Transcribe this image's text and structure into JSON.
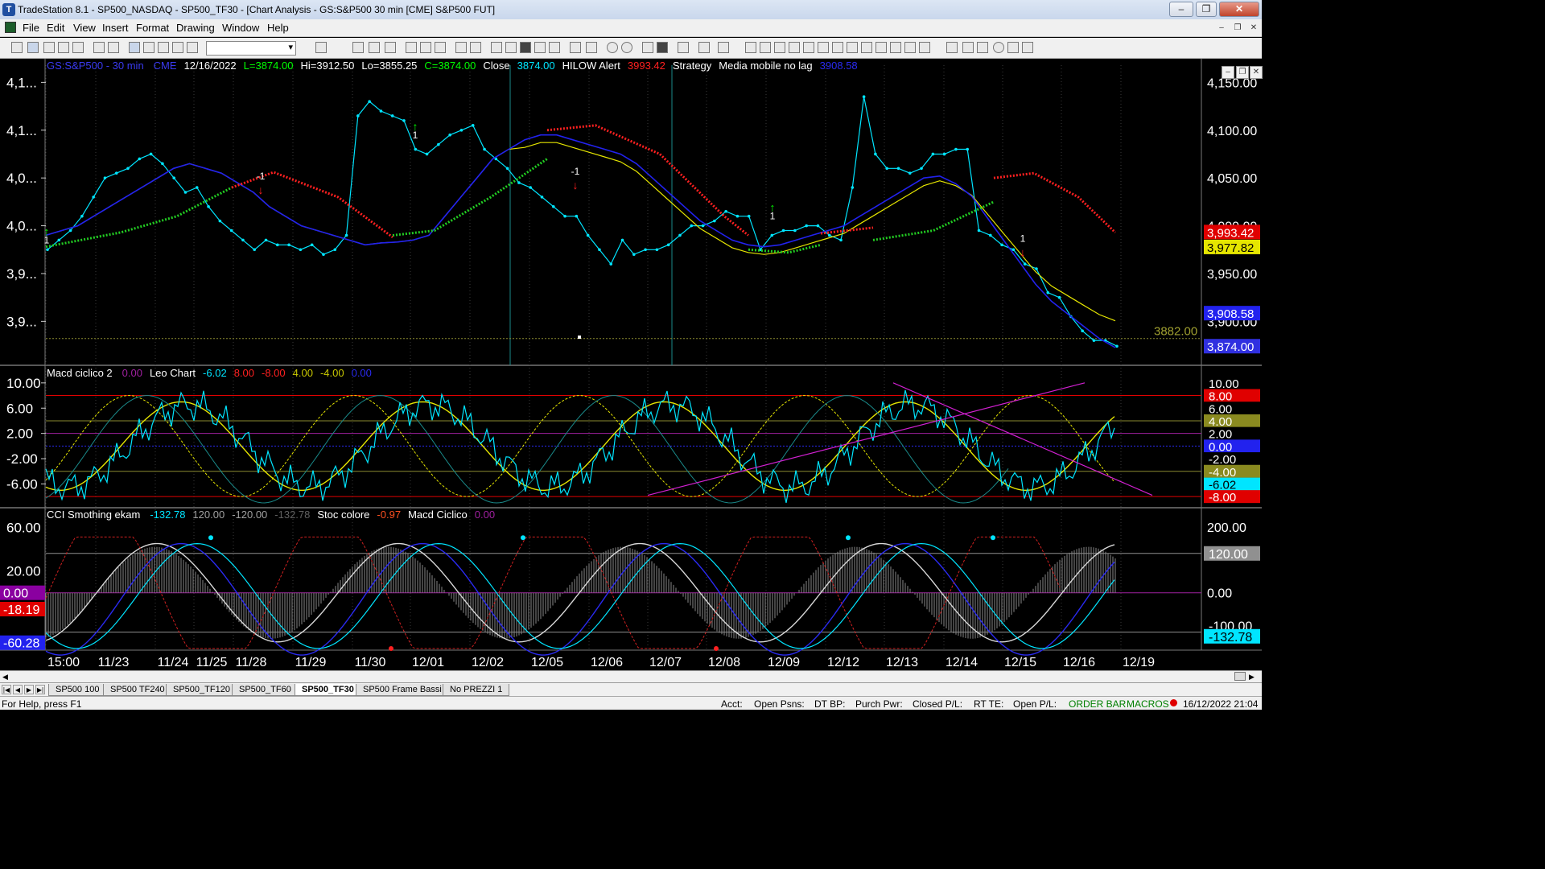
{
  "window": {
    "title": "TradeStation 8.1 - SP500_NASDAQ - SP500_TF30 - [Chart Analysis - GS:S&P500  30 min  [CME] S&P500 FUT]"
  },
  "menu": [
    "File",
    "Edit",
    "View",
    "Insert",
    "Format",
    "Drawing",
    "Window",
    "Help"
  ],
  "header": {
    "items": [
      {
        "t": "GS:S&P500 - 30 min",
        "c": "#3a3af0"
      },
      {
        "t": "CME",
        "c": "#3a3af0"
      },
      {
        "t": "12/16/2022",
        "c": "#ffffff"
      },
      {
        "t": "L=3874.00",
        "c": "#00ff00"
      },
      {
        "t": "Hi=3912.50",
        "c": "#ffffff"
      },
      {
        "t": "Lo=3855.25",
        "c": "#ffffff"
      },
      {
        "t": "C=3874.00",
        "c": "#00ff00"
      },
      {
        "t": "Close",
        "c": "#ffffff"
      },
      {
        "t": "3874.00",
        "c": "#00e5ff"
      },
      {
        "t": "HILOW Alert",
        "c": "#ffffff"
      },
      {
        "t": "3993.42",
        "c": "#ff2020"
      },
      {
        "t": "Strategy",
        "c": "#ffffff"
      },
      {
        "t": "Media mobile no lag",
        "c": "#ffffff"
      },
      {
        "t": "3908.58",
        "c": "#2a2af0"
      }
    ]
  },
  "panel2": {
    "items": [
      {
        "t": "Macd ciclico 2",
        "c": "#ffffff"
      },
      {
        "t": "0.00",
        "c": "#a020a0"
      },
      {
        "t": "Leo Chart",
        "c": "#ffffff"
      },
      {
        "t": "-6.02",
        "c": "#00e5ff"
      },
      {
        "t": "8.00",
        "c": "#ff2020"
      },
      {
        "t": "-8.00",
        "c": "#ff2020"
      },
      {
        "t": "4.00",
        "c": "#c8c800"
      },
      {
        "t": "-4.00",
        "c": "#c8c800"
      },
      {
        "t": "0.00",
        "c": "#2a2af0"
      }
    ]
  },
  "panel3": {
    "items": [
      {
        "t": "CCI Smothing ekam",
        "c": "#ffffff"
      },
      {
        "t": "-132.78",
        "c": "#00e5ff"
      },
      {
        "t": "120.00",
        "c": "#a0a0a0"
      },
      {
        "t": "-120.00",
        "c": "#a0a0a0"
      },
      {
        "t": "-132.78",
        "c": "#606060"
      },
      {
        "t": "Stoc colore",
        "c": "#ffffff"
      },
      {
        "t": "-0.97",
        "c": "#ff5020"
      },
      {
        "t": "Macd Ciclico",
        "c": "#ffffff"
      },
      {
        "t": "0.00",
        "c": "#a020a0"
      }
    ]
  },
  "colors": {
    "bg": "#000000",
    "close": "#00e5ff",
    "ma_yellow": "#e6e600",
    "ma_blue": "#2222ee",
    "hilow_red": "#ff2020",
    "hilow_green": "#22cc22",
    "trend": "#d020d0"
  },
  "chart_data": [
    {
      "type": "line",
      "title": "GS:S&P500 - 30 min",
      "x": [
        "15:00",
        "11/23",
        "11/24",
        "11/25",
        "11/28",
        "11/29",
        "11/30",
        "12/01",
        "12/02",
        "12/05",
        "12/06",
        "12/07",
        "12/08",
        "12/09",
        "12/12",
        "12/13",
        "12/14",
        "12/15",
        "12/16",
        "12/19"
      ],
      "ylim": [
        3854,
        4168
      ],
      "y_ticks_left": [
        "4,1...",
        "4,1...",
        "4,0...",
        "4,0...",
        "3,9...",
        "3,9..."
      ],
      "y_ticks_right": [
        "4,150.00",
        "4,100.00",
        "4,050.00",
        "4,000.00",
        "3,950.00",
        "3,900.00"
      ],
      "reference_line": {
        "label": "3882.00",
        "value": 3882
      },
      "series": [
        {
          "name": "Close",
          "values": [
            3975,
            3985,
            3995,
            4010,
            4030,
            4050,
            4055,
            4060,
            4070,
            4075,
            4065,
            4050,
            4035,
            4040,
            4020,
            4005,
            3995,
            3985,
            3975,
            3985,
            3980,
            3980,
            3975,
            3980,
            3970,
            3975,
            3990,
            4115,
            4130,
            4120,
            4115,
            4110,
            4080,
            4075,
            4085,
            4095,
            4100,
            4105,
            4080,
            4070,
            4060,
            4045,
            4040,
            4030,
            4020,
            4010,
            4010,
            3990,
            3975,
            3960,
            3985,
            3970,
            3975,
            3975,
            3980,
            3990,
            4000,
            4000,
            4005,
            4015,
            4010,
            4010,
            3975,
            3990,
            3995,
            3995,
            4000,
            4000,
            3990,
            3985,
            4040,
            4135,
            4075,
            4060,
            4060,
            4055,
            4060,
            4075,
            4075,
            4080,
            4080,
            3995,
            3990,
            3980,
            3975,
            3960,
            3955,
            3930,
            3925,
            3905,
            3890,
            3880,
            3880,
            3874
          ]
        },
        {
          "name": "Media mobile no lag",
          "values": [
            3990,
            3995,
            4000,
            4010,
            4020,
            4030,
            4040,
            4050,
            4060,
            4065,
            4060,
            4055,
            4045,
            4035,
            4020,
            4010,
            4000,
            3995,
            3990,
            3985,
            3980,
            3982,
            3983,
            3985,
            3990,
            4010,
            4030,
            4050,
            4070,
            4080,
            4090,
            4095,
            4095,
            4090,
            4085,
            4080,
            4075,
            4065,
            4050,
            4035,
            4020,
            4005,
            3995,
            3985,
            3980,
            3978,
            3980,
            3985,
            3990,
            3995,
            4000,
            4010,
            4020,
            4030,
            4040,
            4050,
            4055,
            4050,
            4040,
            4020,
            4000,
            3980,
            3960,
            3945,
            3935,
            3925,
            3915,
            3908.58
          ]
        }
      ],
      "hilow_alert": {
        "last": "3993.42"
      },
      "right_badges": [
        "3,993.42",
        "3,977.82",
        "3,908.58",
        "3,874.00"
      ],
      "strategy_labels": [
        "1",
        "-1",
        "-1",
        "1",
        "1",
        "1"
      ]
    },
    {
      "type": "line",
      "title": "Macd ciclico 2",
      "ylim": [
        -9,
        11
      ],
      "y_ticks": [
        "10.00",
        "6.00",
        "2.00",
        "-2.00",
        "-6.00"
      ],
      "levels": [
        8,
        4,
        0,
        -4,
        -8
      ],
      "right_badges": [
        "10.00",
        "8.00",
        "6.00",
        "4.00",
        "2.00",
        "0.00",
        "-2.00",
        "-4.00",
        "-6.02",
        "-8.00"
      ],
      "series": [
        {
          "name": "Leo Chart",
          "last": -6.02
        }
      ]
    },
    {
      "type": "line",
      "title": "CCI Smothing ekam",
      "ylim": [
        -175,
        225
      ],
      "y_ticks_left": [
        "60.00",
        "20.00"
      ],
      "y_ticks_right": [
        "200.00",
        "0.00"
      ],
      "left_badges": [
        "0.00",
        "-18.19",
        "-60.28"
      ],
      "right_badges": [
        "120.00",
        "-100.00",
        "-132.78"
      ],
      "series": [
        {
          "name": "CCI Smothing ekam",
          "last": -132.78
        },
        {
          "name": "Stoc colore",
          "last": -0.97
        },
        {
          "name": "Macd Ciclico",
          "last": 0.0
        }
      ]
    }
  ],
  "tabs": [
    "SP500 100",
    "SP500 TF240",
    "SP500_TF120",
    "SP500_TF60",
    "SP500_TF30",
    "SP500 Frame Bassi",
    "No PREZZI 1"
  ],
  "active_tab": "SP500_TF30",
  "status": {
    "help": "For Help, press F1",
    "acct": "Acct:",
    "open_psns": "Open Psns:",
    "dt_bp": "DT BP:",
    "purch_pwr": "Purch Pwr:",
    "closed_pl": "Closed P/L:",
    "rt_te": "RT TE:",
    "open_pl": "Open P/L:",
    "order_bar": "ORDER BAR",
    "macros": "MACROS",
    "datetime": "16/12/2022 21:04"
  }
}
